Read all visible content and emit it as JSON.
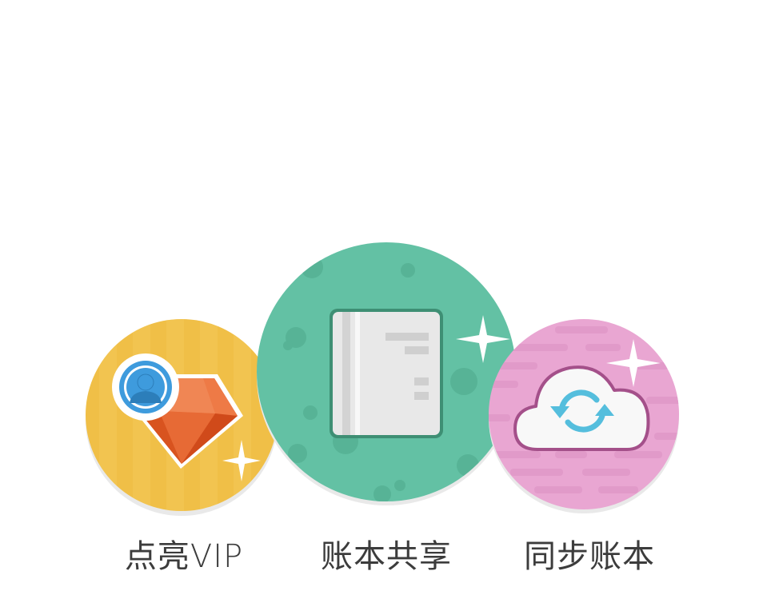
{
  "features": [
    {
      "id": "vip",
      "label": "点亮VIP",
      "icon": "diamond-user-icon",
      "color": "#F0BF47"
    },
    {
      "id": "share",
      "label": "账本共享",
      "icon": "book-icon",
      "color": "#63C1A4"
    },
    {
      "id": "sync",
      "label": "同步账本",
      "icon": "cloud-sync-icon",
      "color": "#E9A6D2"
    }
  ]
}
